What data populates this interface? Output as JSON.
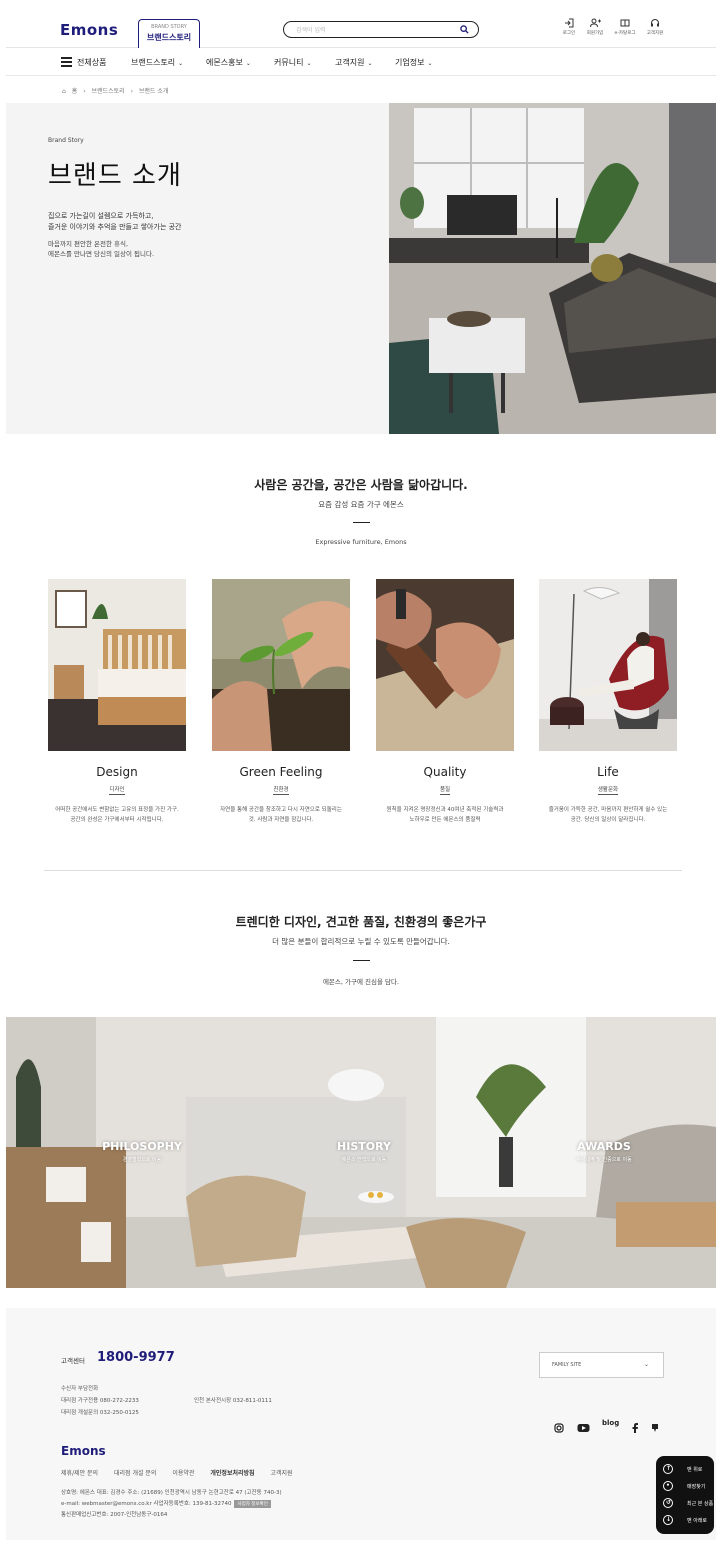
{
  "header": {
    "logo": "Emons",
    "brand_tab_small": "BRAND STORY",
    "brand_tab_label": "브랜드스토리",
    "search_placeholder": "검색어 입력",
    "utils": [
      "로그인",
      "회원가입",
      "e-카탈로그",
      "고객지원"
    ]
  },
  "nav": {
    "all": "전체상품",
    "items": [
      "브랜드스토리",
      "에몬스홍보",
      "커뮤니티",
      "고객지원",
      "기업정보"
    ]
  },
  "breadcrumb": [
    "홈",
    "브랜드스토리",
    "브랜드 소개"
  ],
  "hero": {
    "eyebrow": "Brand Story",
    "title": "브랜드 소개",
    "p1_line1": "집으로 가는길이 설렘으로 가득하고,",
    "p1_line2": "즐거운 이야기와 추억을 만들고 쌓아가는 공간",
    "p2_line1": "마음까지 편안한 온전한 휴식,",
    "p2_line2": "에몬스를 만나면 당신의 일상이 됩니다."
  },
  "section1": {
    "title": "사람은 공간을, 공간은 사람을 닮아갑니다.",
    "subtitle": "요즘 감성 요즘 가구 에몬스",
    "small": "Expressive furniture, Emons",
    "cards": [
      {
        "en": "Design",
        "ko": "디자인",
        "desc1": "어떠한 공간에서도 변함없는 고유의 표정을 가진 가구.",
        "desc2": "공간의 완성은 가구에서부터 시작됩니다."
      },
      {
        "en": "Green Feeling",
        "ko": "친환경",
        "desc1": "자연을 통해 공간을 창조하고 다시 자연으로 되돌리는",
        "desc2": "것. 사람과 자연을 잠깁니다."
      },
      {
        "en": "Quality",
        "ko": "품질",
        "desc1": "원칙을 지켜온 명장정신과 40여년 축적된 기술력과",
        "desc2": "노하우로 만든 에몬스의 품질력"
      },
      {
        "en": "Life",
        "ko": "생활문화",
        "desc1": "즐거움이 가득한 공간, 마음까지 편안하게 쉴수 있는",
        "desc2": "공간. 당신의 일상이 달라집니다."
      }
    ]
  },
  "section2": {
    "title": "트렌디한 디자인, 견고한 품질, 친환경의 좋은가구",
    "subtitle": "더 많은 분들이 합리적으로 누릴 수 있도록 만들어갑니다.",
    "small": "에몬스, 가구에 진심을 담다."
  },
  "banner": [
    {
      "title": "PHILOSOPHY",
      "sub": "경영철학으로 이동"
    },
    {
      "title": "HISTORY",
      "sub": "에몬스 연혁으로 이동"
    },
    {
      "title": "AWARDS",
      "sub": "수상내역 및 인증으로 이동"
    }
  ],
  "footer": {
    "cc_label": "고객센터",
    "cc_number": "1800-9977",
    "row1": "수신자 부담전화",
    "row2a": "대리점 가구전용   080-272-2233",
    "row2b": "인천 본사전시장   032-811-0111",
    "row3": "대리점 개설문의   032-250-0125",
    "family_site": "FAMILY SITE",
    "blog": "blog",
    "logo": "Emons",
    "links": [
      "제휴/제안 문의",
      "대리점 개설 문의",
      "이용약관",
      "개인정보처리방침",
      "고객지원"
    ],
    "info1": "상호명: 에몬스    대표: 김경수    주소: (21689) 인천광역시 남동구 논현고잔로 47 (고잔동 740-3)",
    "info2": "e-mail: webmaster@emons.co.kr    사업자등록번호: 139-81-32740",
    "info2_badge": "사업자 정보확인",
    "info3": "통신판매업신고번호: 2007-인천남동구-0164"
  },
  "quick": [
    "맨 위로",
    "매장찾기",
    "최근 본 상품",
    "맨 아래로"
  ],
  "colors": {
    "brand": "#1f1d7a",
    "quick_bg": "#111111"
  }
}
